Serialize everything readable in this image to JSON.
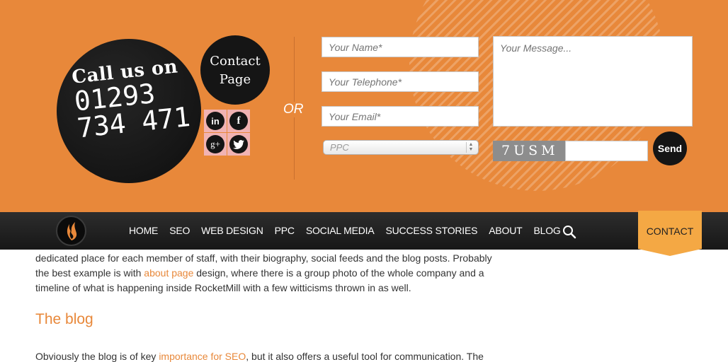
{
  "contact_band": {
    "call_us": {
      "line1": "Call us on",
      "line2": "01293",
      "line3": "734 471"
    },
    "contact_page": {
      "line1": "Contact",
      "line2": "Page"
    },
    "social": {
      "linkedin": "in",
      "facebook": "f",
      "googleplus": "g+",
      "icons": [
        "linkedin-icon",
        "facebook-icon",
        "google-plus-icon",
        "twitter-icon"
      ]
    },
    "or_label": "OR",
    "form": {
      "name_placeholder": "Your Name*",
      "telephone_placeholder": "Your Telephone*",
      "email_placeholder": "Your Email*",
      "message_placeholder": "Your Message...",
      "service_selected": "PPC",
      "captcha_text": "7USM",
      "send_label": "Send"
    },
    "colors": {
      "orange": "#e8883a",
      "dark": "#151515",
      "social_bg": "#f1b3b3"
    }
  },
  "nav": {
    "items": [
      "HOME",
      "SEO",
      "WEB DESIGN",
      "PPC",
      "SOCIAL MEDIA",
      "SUCCESS STORIES",
      "ABOUT",
      "BLOG"
    ],
    "contact_tab": "CONTACT",
    "search_icon": "magnifier-icon",
    "logo_icon": "flame-logo-icon"
  },
  "article": {
    "para1_line1": "dedicated place for each member of staff, with their biography, social feeds and the blog posts. Probably",
    "para1_pre_link": "the best example is with ",
    "para1_link": "about page",
    "para1_post_link": " design, where there is a group photo of the whole company and a",
    "para1_line3": "timeline of what is happening inside RocketMill with a few witticisms thrown in as well.",
    "heading": "The blog",
    "para2_pre_link": "Obviously the blog is of key ",
    "para2_link": "importance for SEO",
    "para2_post_link": ", but it also offers a useful tool for communication. The"
  }
}
